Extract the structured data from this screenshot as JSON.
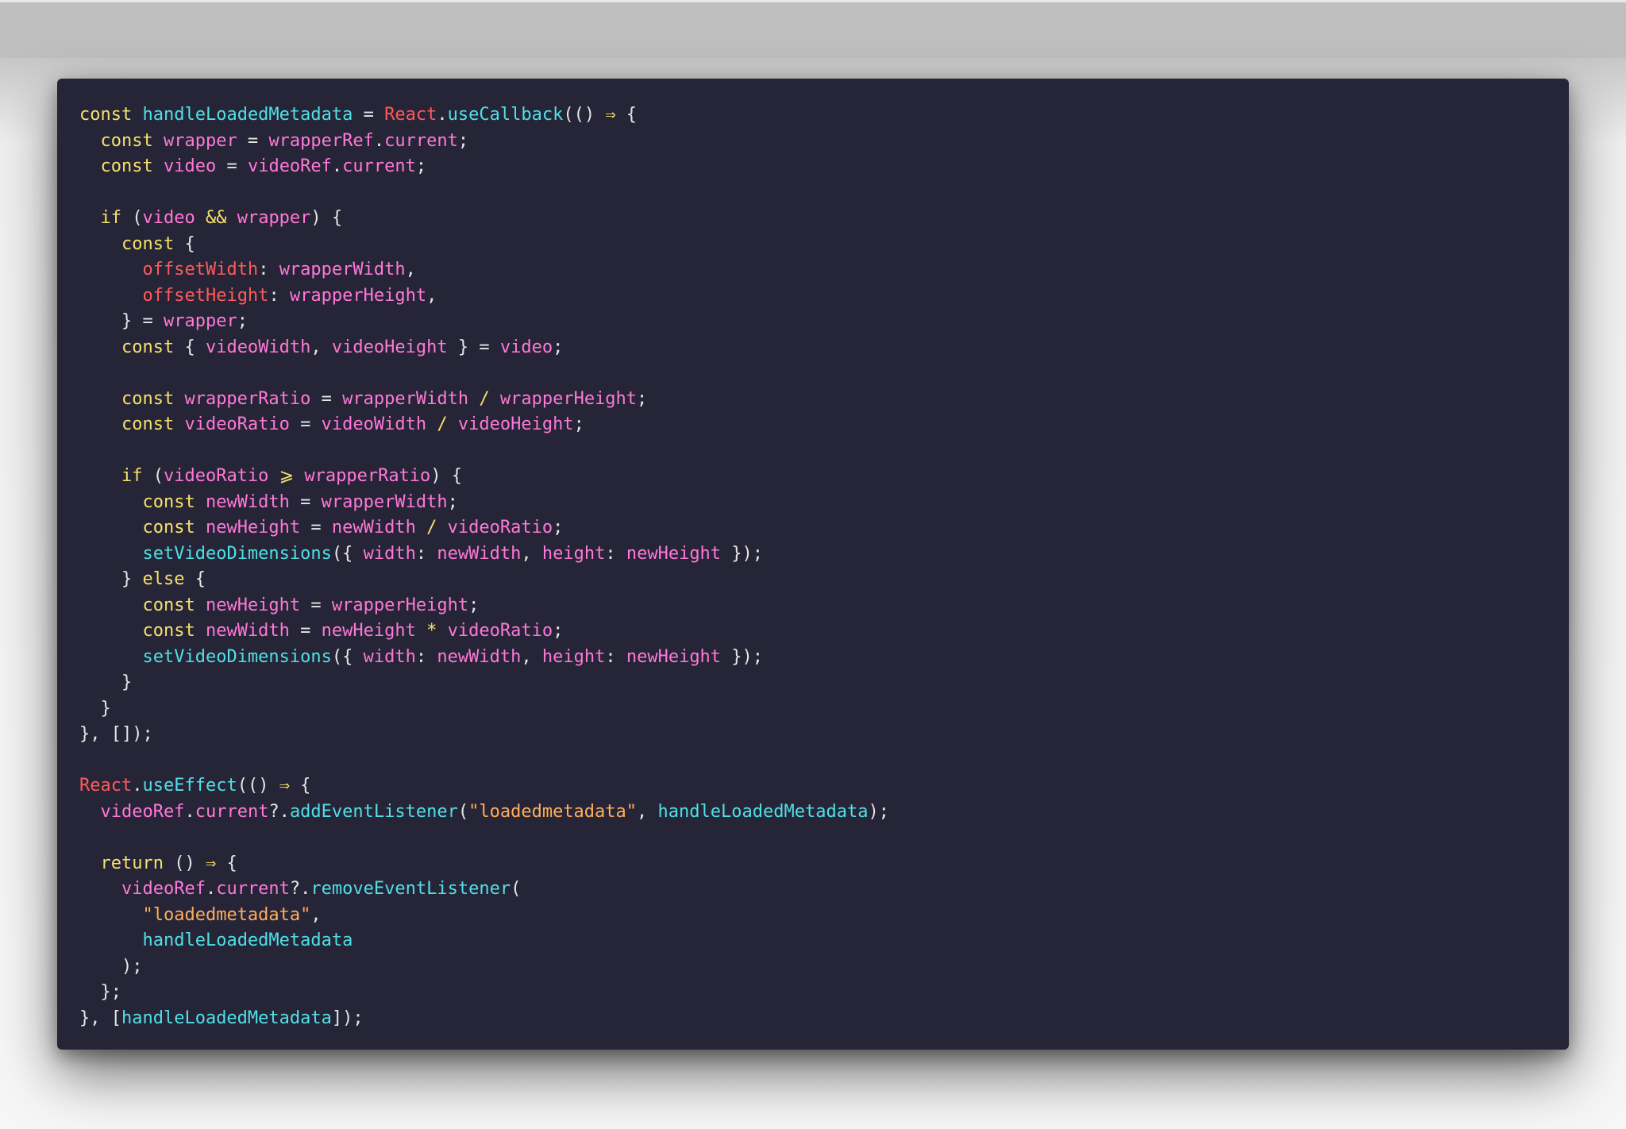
{
  "code": {
    "lines": [
      [
        {
          "t": "const ",
          "c": "kw"
        },
        {
          "t": "handleLoadedMetadata",
          "c": "fn"
        },
        {
          "t": " = ",
          "c": "pun"
        },
        {
          "t": "React",
          "c": "obj"
        },
        {
          "t": ".",
          "c": "pun"
        },
        {
          "t": "useCallback",
          "c": "fn"
        },
        {
          "t": "(() ",
          "c": "pun"
        },
        {
          "t": "⇒",
          "c": "op"
        },
        {
          "t": " {",
          "c": "pun"
        }
      ],
      [
        {
          "t": "  const ",
          "c": "kw"
        },
        {
          "t": "wrapper",
          "c": "var"
        },
        {
          "t": " = ",
          "c": "pun"
        },
        {
          "t": "wrapperRef",
          "c": "var"
        },
        {
          "t": ".",
          "c": "pun"
        },
        {
          "t": "current",
          "c": "var"
        },
        {
          "t": ";",
          "c": "pun"
        }
      ],
      [
        {
          "t": "  const ",
          "c": "kw"
        },
        {
          "t": "video",
          "c": "var"
        },
        {
          "t": " = ",
          "c": "pun"
        },
        {
          "t": "videoRef",
          "c": "var"
        },
        {
          "t": ".",
          "c": "pun"
        },
        {
          "t": "current",
          "c": "var"
        },
        {
          "t": ";",
          "c": "pun"
        }
      ],
      [],
      [
        {
          "t": "  if ",
          "c": "kw"
        },
        {
          "t": "(",
          "c": "pun"
        },
        {
          "t": "video",
          "c": "var"
        },
        {
          "t": " && ",
          "c": "op"
        },
        {
          "t": "wrapper",
          "c": "var"
        },
        {
          "t": ") {",
          "c": "pun"
        }
      ],
      [
        {
          "t": "    const ",
          "c": "kw"
        },
        {
          "t": "{",
          "c": "pun"
        }
      ],
      [
        {
          "t": "      ",
          "c": "pun"
        },
        {
          "t": "offsetWidth",
          "c": "obj"
        },
        {
          "t": ": ",
          "c": "pun"
        },
        {
          "t": "wrapperWidth",
          "c": "var"
        },
        {
          "t": ",",
          "c": "pun"
        }
      ],
      [
        {
          "t": "      ",
          "c": "pun"
        },
        {
          "t": "offsetHeight",
          "c": "obj"
        },
        {
          "t": ": ",
          "c": "pun"
        },
        {
          "t": "wrapperHeight",
          "c": "var"
        },
        {
          "t": ",",
          "c": "pun"
        }
      ],
      [
        {
          "t": "    } = ",
          "c": "pun"
        },
        {
          "t": "wrapper",
          "c": "var"
        },
        {
          "t": ";",
          "c": "pun"
        }
      ],
      [
        {
          "t": "    const ",
          "c": "kw"
        },
        {
          "t": "{ ",
          "c": "pun"
        },
        {
          "t": "videoWidth",
          "c": "var"
        },
        {
          "t": ", ",
          "c": "pun"
        },
        {
          "t": "videoHeight",
          "c": "var"
        },
        {
          "t": " } = ",
          "c": "pun"
        },
        {
          "t": "video",
          "c": "var"
        },
        {
          "t": ";",
          "c": "pun"
        }
      ],
      [],
      [
        {
          "t": "    const ",
          "c": "kw"
        },
        {
          "t": "wrapperRatio",
          "c": "var"
        },
        {
          "t": " = ",
          "c": "pun"
        },
        {
          "t": "wrapperWidth",
          "c": "var"
        },
        {
          "t": " / ",
          "c": "op"
        },
        {
          "t": "wrapperHeight",
          "c": "var"
        },
        {
          "t": ";",
          "c": "pun"
        }
      ],
      [
        {
          "t": "    const ",
          "c": "kw"
        },
        {
          "t": "videoRatio",
          "c": "var"
        },
        {
          "t": " = ",
          "c": "pun"
        },
        {
          "t": "videoWidth",
          "c": "var"
        },
        {
          "t": " / ",
          "c": "op"
        },
        {
          "t": "videoHeight",
          "c": "var"
        },
        {
          "t": ";",
          "c": "pun"
        }
      ],
      [],
      [
        {
          "t": "    if ",
          "c": "kw"
        },
        {
          "t": "(",
          "c": "pun"
        },
        {
          "t": "videoRatio",
          "c": "var"
        },
        {
          "t": " ⩾ ",
          "c": "op"
        },
        {
          "t": "wrapperRatio",
          "c": "var"
        },
        {
          "t": ") {",
          "c": "pun"
        }
      ],
      [
        {
          "t": "      const ",
          "c": "kw"
        },
        {
          "t": "newWidth",
          "c": "var"
        },
        {
          "t": " = ",
          "c": "pun"
        },
        {
          "t": "wrapperWidth",
          "c": "var"
        },
        {
          "t": ";",
          "c": "pun"
        }
      ],
      [
        {
          "t": "      const ",
          "c": "kw"
        },
        {
          "t": "newHeight",
          "c": "var"
        },
        {
          "t": " = ",
          "c": "pun"
        },
        {
          "t": "newWidth",
          "c": "var"
        },
        {
          "t": " / ",
          "c": "op"
        },
        {
          "t": "videoRatio",
          "c": "var"
        },
        {
          "t": ";",
          "c": "pun"
        }
      ],
      [
        {
          "t": "      ",
          "c": "pun"
        },
        {
          "t": "setVideoDimensions",
          "c": "fn"
        },
        {
          "t": "({ ",
          "c": "pun"
        },
        {
          "t": "width",
          "c": "var"
        },
        {
          "t": ": ",
          "c": "pun"
        },
        {
          "t": "newWidth",
          "c": "var"
        },
        {
          "t": ", ",
          "c": "pun"
        },
        {
          "t": "height",
          "c": "var"
        },
        {
          "t": ": ",
          "c": "pun"
        },
        {
          "t": "newHeight",
          "c": "var"
        },
        {
          "t": " });",
          "c": "pun"
        }
      ],
      [
        {
          "t": "    } ",
          "c": "pun"
        },
        {
          "t": "else ",
          "c": "kw"
        },
        {
          "t": "{",
          "c": "pun"
        }
      ],
      [
        {
          "t": "      const ",
          "c": "kw"
        },
        {
          "t": "newHeight",
          "c": "var"
        },
        {
          "t": " = ",
          "c": "pun"
        },
        {
          "t": "wrapperHeight",
          "c": "var"
        },
        {
          "t": ";",
          "c": "pun"
        }
      ],
      [
        {
          "t": "      const ",
          "c": "kw"
        },
        {
          "t": "newWidth",
          "c": "var"
        },
        {
          "t": " = ",
          "c": "pun"
        },
        {
          "t": "newHeight",
          "c": "var"
        },
        {
          "t": " * ",
          "c": "op"
        },
        {
          "t": "videoRatio",
          "c": "var"
        },
        {
          "t": ";",
          "c": "pun"
        }
      ],
      [
        {
          "t": "      ",
          "c": "pun"
        },
        {
          "t": "setVideoDimensions",
          "c": "fn"
        },
        {
          "t": "({ ",
          "c": "pun"
        },
        {
          "t": "width",
          "c": "var"
        },
        {
          "t": ": ",
          "c": "pun"
        },
        {
          "t": "newWidth",
          "c": "var"
        },
        {
          "t": ", ",
          "c": "pun"
        },
        {
          "t": "height",
          "c": "var"
        },
        {
          "t": ": ",
          "c": "pun"
        },
        {
          "t": "newHeight",
          "c": "var"
        },
        {
          "t": " });",
          "c": "pun"
        }
      ],
      [
        {
          "t": "    }",
          "c": "pun"
        }
      ],
      [
        {
          "t": "  }",
          "c": "pun"
        }
      ],
      [
        {
          "t": "}, []);",
          "c": "pun"
        }
      ],
      [],
      [
        {
          "t": "React",
          "c": "obj"
        },
        {
          "t": ".",
          "c": "pun"
        },
        {
          "t": "useEffect",
          "c": "fn"
        },
        {
          "t": "(() ",
          "c": "pun"
        },
        {
          "t": "⇒",
          "c": "op"
        },
        {
          "t": " {",
          "c": "pun"
        }
      ],
      [
        {
          "t": "  ",
          "c": "pun"
        },
        {
          "t": "videoRef",
          "c": "var"
        },
        {
          "t": ".",
          "c": "pun"
        },
        {
          "t": "current",
          "c": "var"
        },
        {
          "t": "?.",
          "c": "pun"
        },
        {
          "t": "addEventListener",
          "c": "fn"
        },
        {
          "t": "(",
          "c": "pun"
        },
        {
          "t": "\"loadedmetadata\"",
          "c": "str"
        },
        {
          "t": ", ",
          "c": "pun"
        },
        {
          "t": "handleLoadedMetadata",
          "c": "fn"
        },
        {
          "t": ");",
          "c": "pun"
        }
      ],
      [],
      [
        {
          "t": "  return ",
          "c": "kw"
        },
        {
          "t": "() ",
          "c": "pun"
        },
        {
          "t": "⇒",
          "c": "op"
        },
        {
          "t": " {",
          "c": "pun"
        }
      ],
      [
        {
          "t": "    ",
          "c": "pun"
        },
        {
          "t": "videoRef",
          "c": "var"
        },
        {
          "t": ".",
          "c": "pun"
        },
        {
          "t": "current",
          "c": "var"
        },
        {
          "t": "?.",
          "c": "pun"
        },
        {
          "t": "removeEventListener",
          "c": "fn"
        },
        {
          "t": "(",
          "c": "pun"
        }
      ],
      [
        {
          "t": "      ",
          "c": "pun"
        },
        {
          "t": "\"loadedmetadata\"",
          "c": "str"
        },
        {
          "t": ",",
          "c": "pun"
        }
      ],
      [
        {
          "t": "      ",
          "c": "pun"
        },
        {
          "t": "handleLoadedMetadata",
          "c": "fn"
        }
      ],
      [
        {
          "t": "    );",
          "c": "pun"
        }
      ],
      [
        {
          "t": "  };",
          "c": "pun"
        }
      ],
      [
        {
          "t": "}, [",
          "c": "pun"
        },
        {
          "t": "handleLoadedMetadata",
          "c": "fn"
        },
        {
          "t": "]);",
          "c": "pun"
        }
      ]
    ]
  },
  "colors": {
    "background": "#262537",
    "keyword": "#f5e16a",
    "function": "#4fe0e6",
    "variable": "#ff78d8",
    "object": "#ff5a5a",
    "string": "#ffad5c"
  }
}
